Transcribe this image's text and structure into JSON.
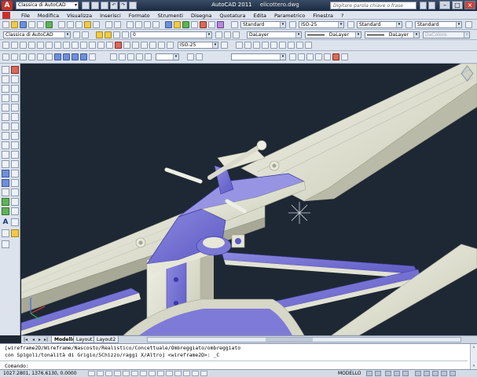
{
  "title_bar": {
    "workspace": "Classica di AutoCAD",
    "app_version": "AutoCAD 2011",
    "filename": "elicottero.dwg",
    "help_search_placeholder": "Digitare parola chiave o frase"
  },
  "menu": [
    "File",
    "Modifica",
    "Visualizza",
    "Inserisci",
    "Formato",
    "Strumenti",
    "Disegna",
    "Quotatura",
    "Edita",
    "Parametrico",
    "Finestra",
    "?"
  ],
  "toolbar_row1": {
    "text_style": "Standard",
    "dim_style": "ISO-25",
    "table_style": "Standard",
    "multileader_style": "Standard"
  },
  "toolbar_row2": {
    "workspace": "Classica di AutoCAD",
    "layer": "0",
    "color": "DaLayer",
    "linetype": "DaLayer",
    "lineweight": "DaLayer",
    "plot_style": "DaColore"
  },
  "toolbar_row3": {
    "dim_style": "ISO-25"
  },
  "layout_tabs": [
    "Modello",
    "Layout1",
    "Layout2"
  ],
  "active_tab": "Modello",
  "command_history": [
    "[wireframe2D/Wireframe/Nascosto/Realistico/Concettuale/Ombreggiato/ombreggiato",
    "con Spigoli/tonalità di Grigio/SChizzo/raggi X/Altro] <wireframe2D>: _C"
  ],
  "command_prompt": "Comando:",
  "status": {
    "coordinates": "1027.2801, 1376.6130, 0.0000",
    "model_label": "MODELLO"
  },
  "colors": {
    "viewport_bg": "#1e2834",
    "model_light": "#e5e6d6",
    "model_shadow": "#7a78d8",
    "titlebar": "#1b2a40"
  },
  "icons": [
    "app-logo-icon",
    "crosshair-cursor-icon",
    "ucs-icon",
    "viewcube-icon",
    "help-search-icon"
  ]
}
